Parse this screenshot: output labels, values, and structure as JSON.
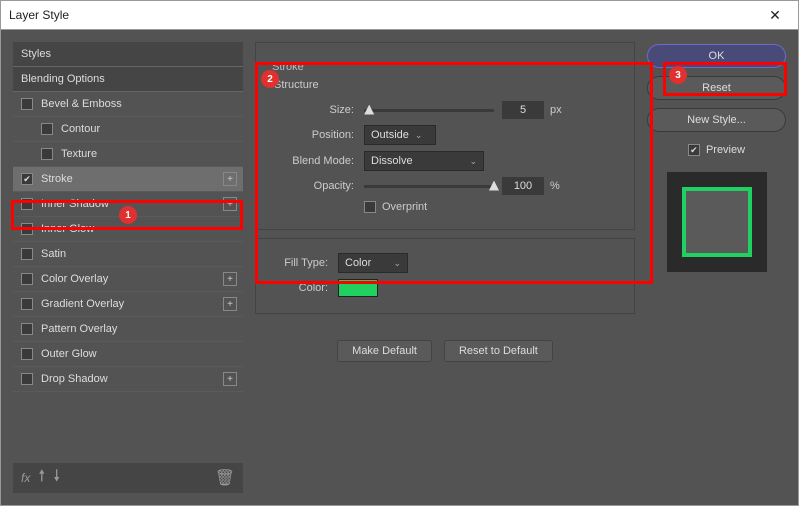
{
  "window": {
    "title": "Layer Style"
  },
  "sidebar": {
    "styles": "Styles",
    "blending": "Blending Options",
    "bevel": "Bevel & Emboss",
    "contour": "Contour",
    "texture": "Texture",
    "stroke": "Stroke",
    "innerShadow": "Inner Shadow",
    "innerGlow": "Inner Glow",
    "satin": "Satin",
    "colorOverlay": "Color Overlay",
    "gradientOverlay": "Gradient Overlay",
    "patternOverlay": "Pattern Overlay",
    "outerGlow": "Outer Glow",
    "dropShadow": "Drop Shadow",
    "fxLabel": "fx"
  },
  "stroke": {
    "section": "Stroke",
    "structure": "Structure",
    "sizeLabel": "Size:",
    "sizeVal": "5",
    "sizeUnit": "px",
    "positionLabel": "Position:",
    "positionVal": "Outside",
    "blendLabel": "Blend Mode:",
    "blendVal": "Dissolve",
    "opacityLabel": "Opacity:",
    "opacityVal": "100",
    "opacityUnit": "%",
    "overprint": "Overprint",
    "fillTypeLabel": "Fill Type:",
    "fillTypeVal": "Color",
    "colorLabel": "Color:",
    "colorHex": "#20d060"
  },
  "buttons": {
    "makeDefault": "Make Default",
    "resetDefault": "Reset to Default",
    "ok": "OK",
    "reset": "Reset",
    "newStyle": "New Style...",
    "preview": "Preview"
  },
  "annotations": {
    "a1": "1",
    "a2": "2",
    "a3": "3"
  }
}
